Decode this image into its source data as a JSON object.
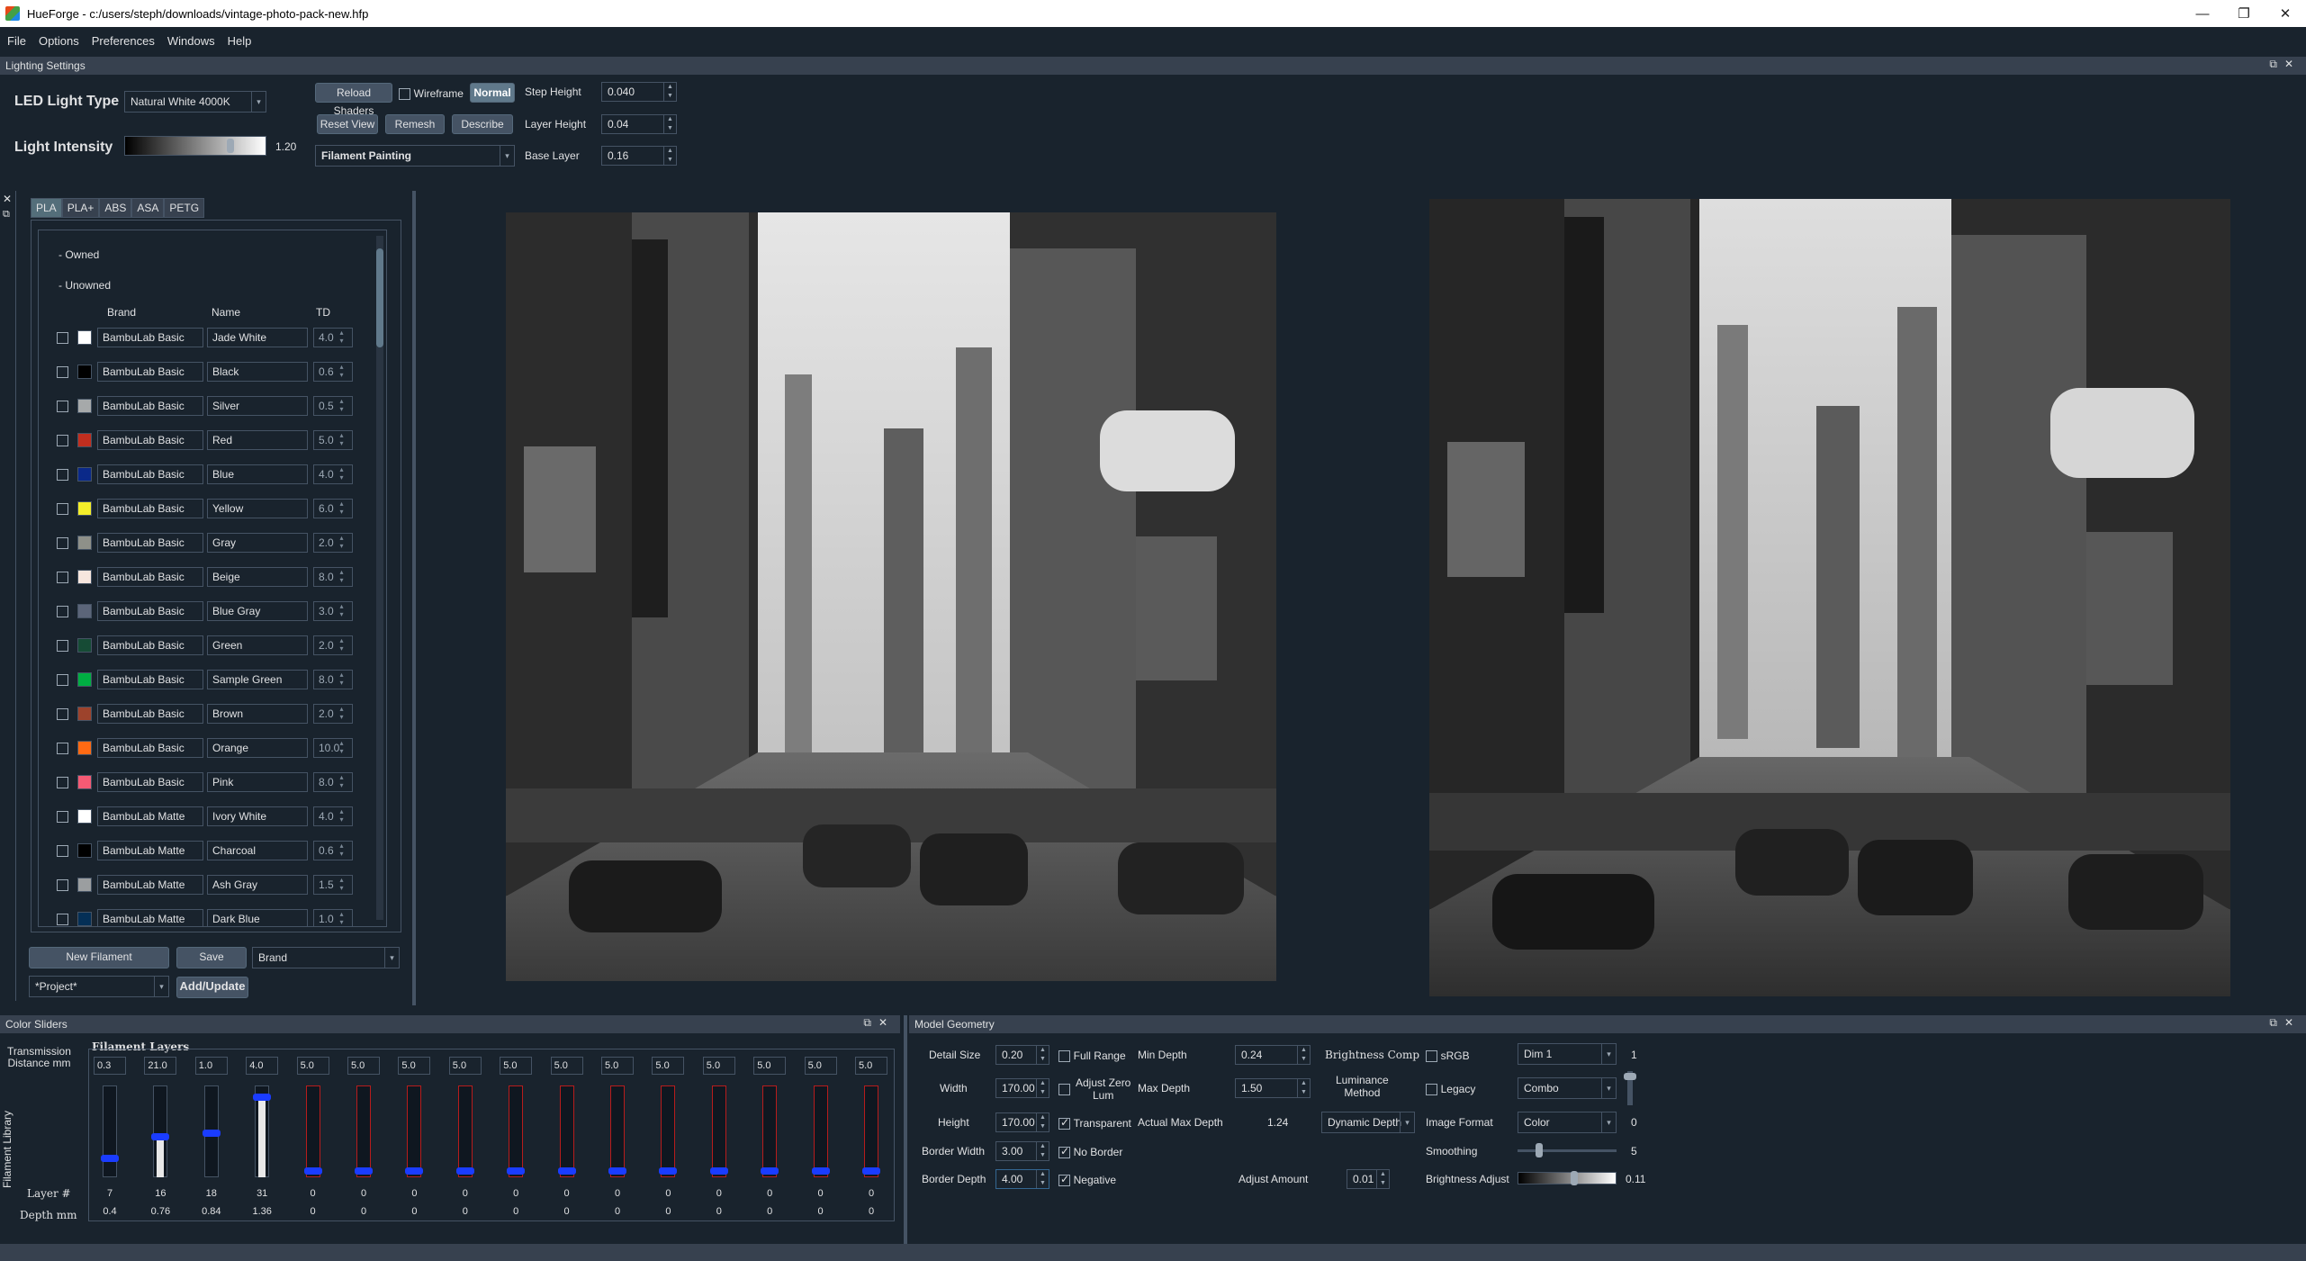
{
  "window": {
    "title": "HueForge - c:/users/steph/downloads/vintage-photo-pack-new.hfp",
    "controls": [
      "—",
      "❐",
      "✕"
    ]
  },
  "menu": [
    "File",
    "Options",
    "Preferences",
    "Windows",
    "Help"
  ],
  "lighting": {
    "panel_title": "Lighting Settings",
    "led_label": "LED Light Type",
    "led_value": "Natural White 4000K",
    "intensity_label": "Light Intensity",
    "intensity_value": "1.20",
    "intensity_level": 0.75,
    "reload_shaders": "Reload Shaders",
    "wireframe": "Wireframe",
    "normal": "Normal",
    "reset_view": "Reset View",
    "remesh": "Remesh",
    "describe": "Describe",
    "mode_value": "Filament Painting",
    "step_height_label": "Step Height",
    "step_height": "0.040",
    "layer_height_label": "Layer Height",
    "layer_height": "0.04",
    "base_layer_label": "Base Layer",
    "base_layer": "0.16"
  },
  "library": {
    "side_label": "Filament Library",
    "tabs": [
      "PLA",
      "PLA+",
      "ABS",
      "ASA",
      "PETG"
    ],
    "owned": "- Owned",
    "unowned": "- Unowned",
    "col_brand": "Brand",
    "col_name": "Name",
    "col_td": "TD",
    "rows": [
      {
        "brand": "BambuLab Basic",
        "name": "Jade White",
        "td": "4.0",
        "color": "#ffffff"
      },
      {
        "brand": "BambuLab Basic",
        "name": "Black",
        "td": "0.6",
        "color": "#000000"
      },
      {
        "brand": "BambuLab Basic",
        "name": "Silver",
        "td": "0.5",
        "color": "#a6a9aa"
      },
      {
        "brand": "BambuLab Basic",
        "name": "Red",
        "td": "5.0",
        "color": "#c12e1f"
      },
      {
        "brand": "BambuLab Basic",
        "name": "Blue",
        "td": "4.0",
        "color": "#0a2989"
      },
      {
        "brand": "BambuLab Basic",
        "name": "Yellow",
        "td": "6.0",
        "color": "#f4ee2a"
      },
      {
        "brand": "BambuLab Basic",
        "name": "Gray",
        "td": "2.0",
        "color": "#8e9089"
      },
      {
        "brand": "BambuLab Basic",
        "name": "Beige",
        "td": "8.0",
        "color": "#f7e6de"
      },
      {
        "brand": "BambuLab Basic",
        "name": "Blue Gray",
        "td": "3.0",
        "color": "#5b6579"
      },
      {
        "brand": "BambuLab Basic",
        "name": "Green",
        "td": "2.0",
        "color": "#164b35"
      },
      {
        "brand": "BambuLab Basic",
        "name": "Sample Green",
        "td": "8.0",
        "color": "#00ae42"
      },
      {
        "brand": "BambuLab Basic",
        "name": "Brown",
        "td": "2.0",
        "color": "#9d432c"
      },
      {
        "brand": "BambuLab Basic",
        "name": "Orange",
        "td": "10.0",
        "color": "#ff6a13"
      },
      {
        "brand": "BambuLab Basic",
        "name": "Pink",
        "td": "8.0",
        "color": "#f55a74"
      },
      {
        "brand": "BambuLab Matte",
        "name": "Ivory White",
        "td": "4.0",
        "color": "#ffffff"
      },
      {
        "brand": "BambuLab Matte",
        "name": "Charcoal",
        "td": "0.6",
        "color": "#000000"
      },
      {
        "brand": "BambuLab Matte",
        "name": "Ash Gray",
        "td": "1.5",
        "color": "#9b9ea0"
      },
      {
        "brand": "BambuLab Matte",
        "name": "Dark Blue",
        "td": "1.0",
        "color": "#042f56"
      }
    ],
    "new_filament": "New Filament",
    "save": "Save",
    "sort_value": "Brand",
    "project_value": "*Project*",
    "add_update": "Add/Update"
  },
  "color_sliders": {
    "panel_title": "Color Sliders",
    "transmission": "Transmission\nDistance mm",
    "filament_layers": "Filament Layers",
    "layer_label": "Layer #",
    "depth_label": "Depth mm",
    "sliders": [
      {
        "td": "0.3",
        "layer": "7",
        "depth": "0.4",
        "level": 0.18,
        "white": false
      },
      {
        "td": "21.0",
        "layer": "16",
        "depth": "0.76",
        "level": 0.44,
        "white": true
      },
      {
        "td": "1.0",
        "layer": "18",
        "depth": "0.84",
        "level": 0.48,
        "white": false
      },
      {
        "td": "4.0",
        "layer": "31",
        "depth": "1.36",
        "level": 0.9,
        "white": true
      },
      {
        "td": "5.0",
        "layer": "0",
        "depth": "0",
        "level": 0.03,
        "white": false
      },
      {
        "td": "5.0",
        "layer": "0",
        "depth": "0",
        "level": 0.03,
        "white": false
      },
      {
        "td": "5.0",
        "layer": "0",
        "depth": "0",
        "level": 0.03,
        "white": false
      },
      {
        "td": "5.0",
        "layer": "0",
        "depth": "0",
        "level": 0.03,
        "white": false
      },
      {
        "td": "5.0",
        "layer": "0",
        "depth": "0",
        "level": 0.03,
        "white": false
      },
      {
        "td": "5.0",
        "layer": "0",
        "depth": "0",
        "level": 0.03,
        "white": false
      },
      {
        "td": "5.0",
        "layer": "0",
        "depth": "0",
        "level": 0.03,
        "white": false
      },
      {
        "td": "5.0",
        "layer": "0",
        "depth": "0",
        "level": 0.03,
        "white": false
      },
      {
        "td": "5.0",
        "layer": "0",
        "depth": "0",
        "level": 0.03,
        "white": false
      },
      {
        "td": "5.0",
        "layer": "0",
        "depth": "0",
        "level": 0.03,
        "white": false
      },
      {
        "td": "5.0",
        "layer": "0",
        "depth": "0",
        "level": 0.03,
        "white": false
      },
      {
        "td": "5.0",
        "layer": "0",
        "depth": "0",
        "level": 0.03,
        "white": false
      }
    ]
  },
  "geometry": {
    "panel_title": "Model Geometry",
    "detail_size_label": "Detail Size",
    "detail_size": "0.20",
    "width_label": "Width",
    "width": "170.00",
    "height_label": "Height",
    "height": "170.00",
    "border_width_label": "Border Width",
    "border_width": "3.00",
    "border_depth_label": "Border Depth",
    "border_depth": "4.00",
    "full_range": "Full Range",
    "adjust_zero_lum": "Adjust Zero\nLum",
    "transparent": "Transparent",
    "no_border": "No Border",
    "negative": "Negative",
    "min_depth_label": "Min Depth",
    "min_depth": "0.24",
    "max_depth_label": "Max Depth",
    "max_depth": "1.50",
    "actual_max_label": "Actual Max Depth",
    "actual_max": "1.24",
    "adjust_amount_label": "Adjust Amount",
    "adjust_amount": "0.01",
    "brightness_comp": "Brightness Comp",
    "luminance_method": "Luminance\nMethod",
    "dynamic_depth": "Dynamic Depth",
    "srgb": "sRGB",
    "legacy": "Legacy",
    "image_format_label": "Image Format",
    "image_format": "Color",
    "smoothing_label": "Smoothing",
    "smoothing": "5",
    "brightness_adjust_label": "Brightness Adjust",
    "brightness_adjust": "0.11",
    "dim_value": "Dim 1",
    "dim_num": "1",
    "lum_combo": "Combo",
    "format_num": "0"
  }
}
